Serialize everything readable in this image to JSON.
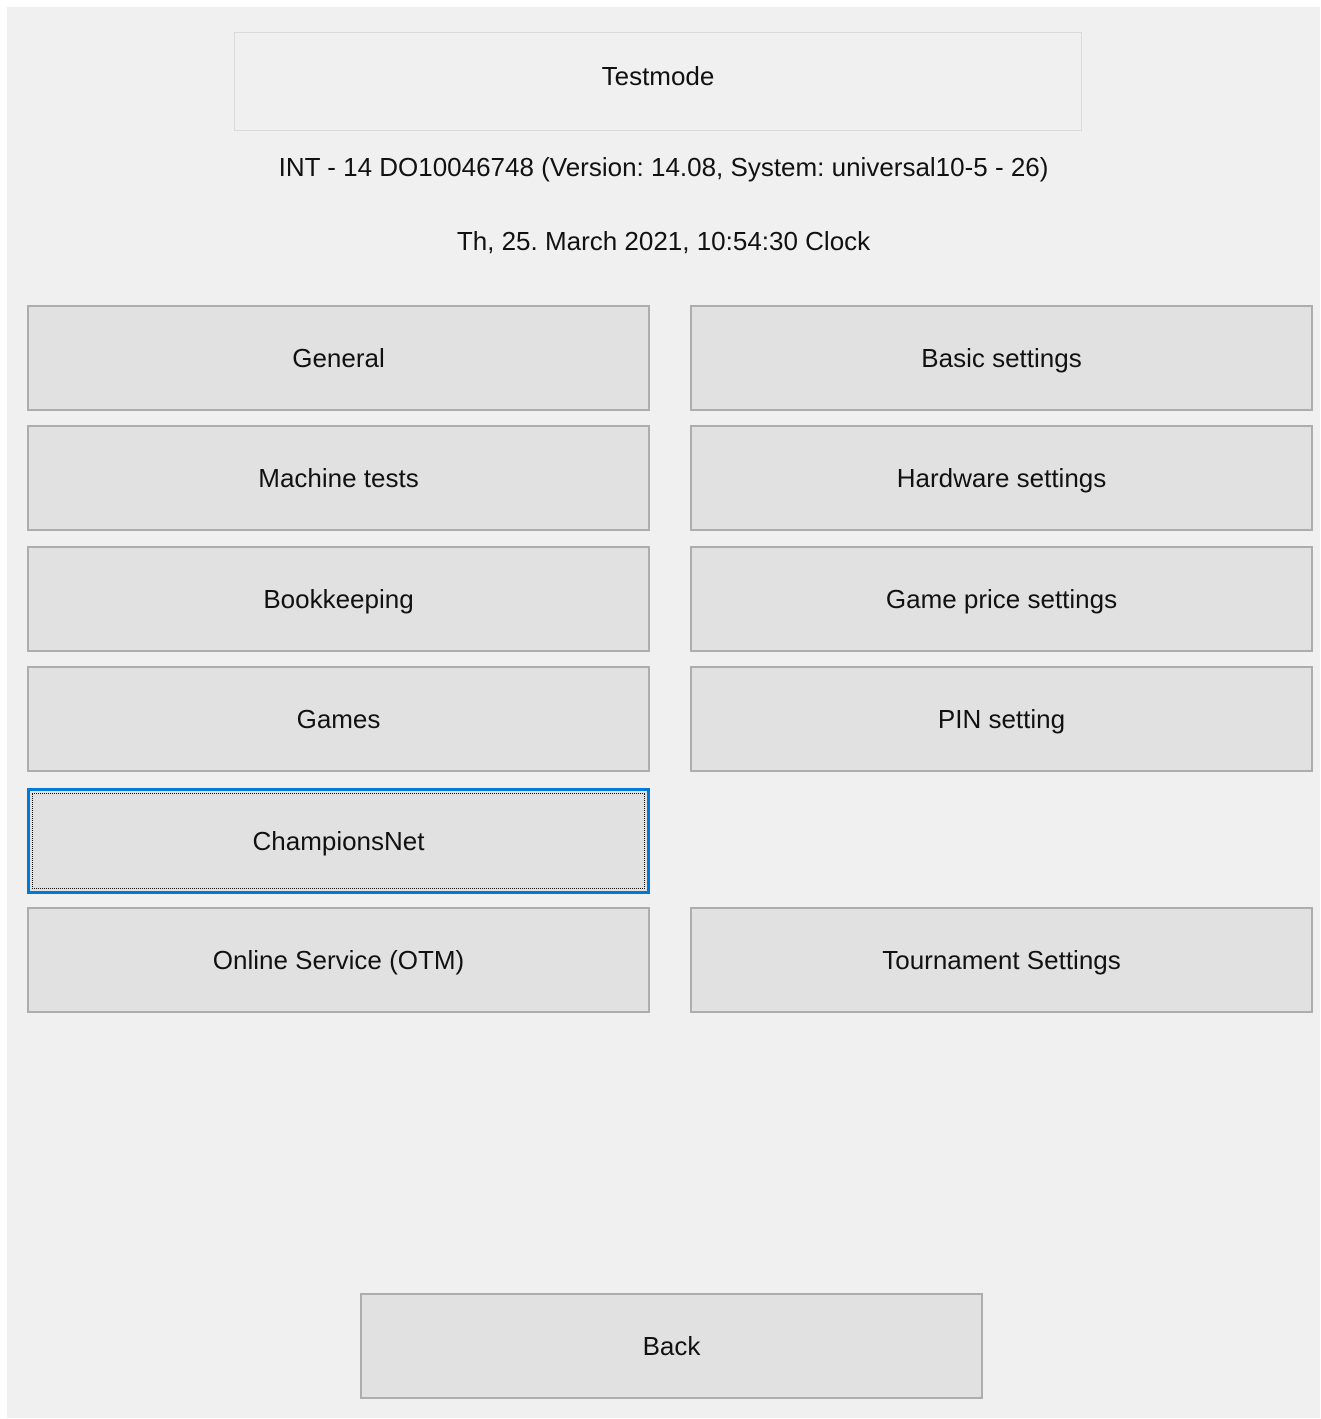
{
  "title": "Testmode",
  "system_info": "INT - 14 DO10046748 (Version: 14.08, System: universal10-5 - 26)",
  "datetime": "Th, 25. March 2021, 10:54:30 Clock",
  "menu": {
    "left": [
      "General",
      "Machine tests",
      "Bookkeeping",
      "Games",
      "ChampionsNet",
      "Online Service (OTM)"
    ],
    "right": [
      "Basic settings",
      "Hardware settings",
      "Game price settings",
      "PIN setting",
      "Tournament Settings"
    ],
    "focused_item": "ChampionsNet"
  },
  "back_label": "Back",
  "colors": {
    "window_bg": "#f0f0f0",
    "button_bg": "#e1e1e1",
    "button_border": "#adadad",
    "focus_border": "#0078d7"
  }
}
